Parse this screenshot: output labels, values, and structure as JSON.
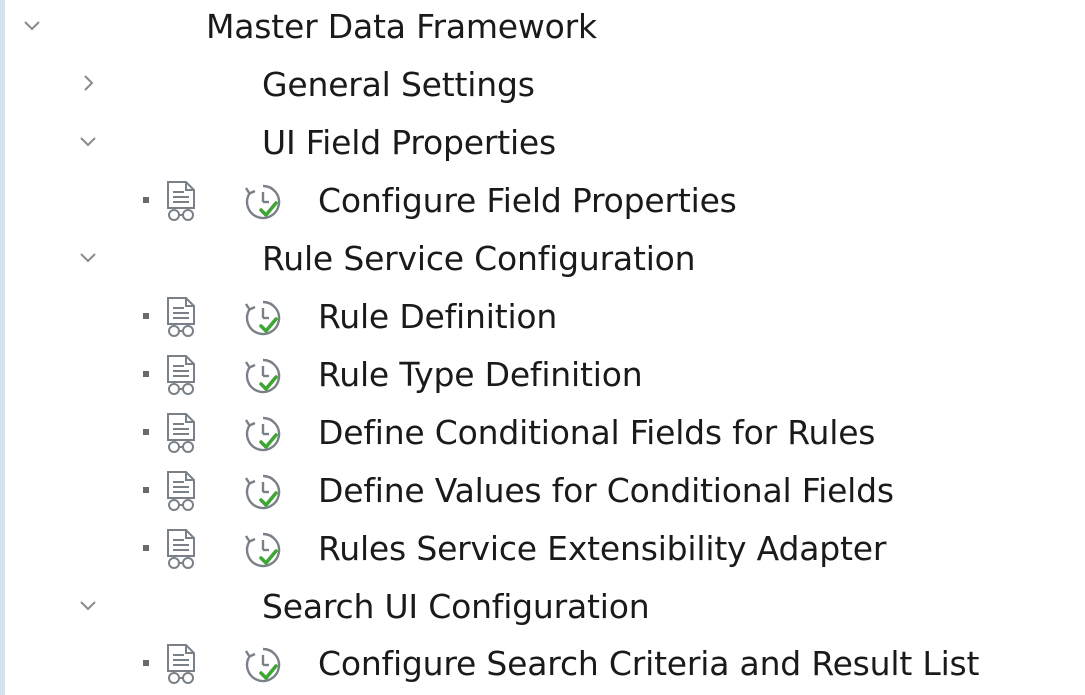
{
  "tree": {
    "root": {
      "label": "Master Data Framework",
      "state": "expanded",
      "toggle_icon": "chevron-down-icon"
    },
    "items": [
      {
        "label": "General Settings",
        "level": 1,
        "type": "folder",
        "state": "collapsed",
        "toggle_icon": "chevron-right-icon"
      },
      {
        "label": "UI Field Properties",
        "level": 1,
        "type": "folder",
        "state": "expanded",
        "toggle_icon": "chevron-down-icon"
      },
      {
        "label": "Configure Field Properties",
        "level": 2,
        "type": "activity",
        "icons": [
          "documentation-icon",
          "execute-activity-icon"
        ]
      },
      {
        "label": "Rule Service Configuration",
        "level": 1,
        "type": "folder",
        "state": "expanded",
        "toggle_icon": "chevron-down-icon"
      },
      {
        "label": "Rule Definition",
        "level": 2,
        "type": "activity",
        "icons": [
          "documentation-icon",
          "execute-activity-icon"
        ]
      },
      {
        "label": "Rule Type Definition",
        "level": 2,
        "type": "activity",
        "icons": [
          "documentation-icon",
          "execute-activity-icon"
        ]
      },
      {
        "label": "Define Conditional Fields for Rules",
        "level": 2,
        "type": "activity",
        "icons": [
          "documentation-icon",
          "execute-activity-icon"
        ]
      },
      {
        "label": "Define Values for Conditional Fields",
        "level": 2,
        "type": "activity",
        "icons": [
          "documentation-icon",
          "execute-activity-icon"
        ]
      },
      {
        "label": "Rules Service Extensibility Adapter",
        "level": 2,
        "type": "activity",
        "icons": [
          "documentation-icon",
          "execute-activity-icon"
        ]
      },
      {
        "label": "Search UI Configuration",
        "level": 1,
        "type": "folder",
        "state": "expanded",
        "toggle_icon": "chevron-down-icon"
      },
      {
        "label": "Configure Search Criteria and Result List",
        "level": 2,
        "type": "activity",
        "icons": [
          "documentation-icon",
          "execute-activity-icon"
        ]
      }
    ]
  },
  "colors": {
    "text": "#1a1a1a",
    "chevron": "#8a8a8a",
    "icon_gray": "#7a8088",
    "check_green": "#3fa535",
    "rail": "#d6e2ee"
  }
}
